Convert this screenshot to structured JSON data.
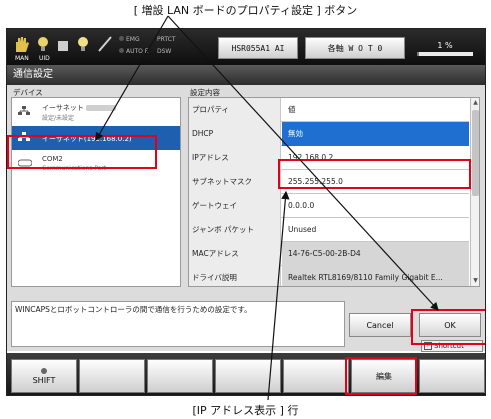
{
  "annotations": {
    "top": "[ 増設 LAN ボードのプロパティ設定 ] ボタン",
    "bottom": "[IP アドレス表示 ] 行"
  },
  "toolbar": {
    "icon_labels": [
      "MAN",
      "UID"
    ],
    "emg_label": "EMG",
    "auto_label": "AUTO E",
    "prtct_label": "PRTCT",
    "dsw_label": "DSW",
    "robot_button": "HSR055A1 AI",
    "axis_button": "各軸 W O T 0",
    "override_value": "1 %",
    "override_level": 0.01
  },
  "window": {
    "title": "通信設定"
  },
  "devices": {
    "header": "デバイス",
    "items": [
      {
        "line1": "イーサネット",
        "line2": "設定/未設定"
      },
      {
        "line1": "イーサネット(192.168.0.2)",
        "line2": ""
      },
      {
        "line1": "COM2",
        "line2": "Communications Port"
      }
    ]
  },
  "settings": {
    "header": "設定内容",
    "rows": [
      {
        "key": "プロパティ",
        "value": "値"
      },
      {
        "key": "DHCP",
        "value": "無効"
      },
      {
        "key": "IPアドレス",
        "value": "192.168.0.2"
      },
      {
        "key": "サブネットマスク",
        "value": "255.255.255.0"
      },
      {
        "key": "ゲートウェイ",
        "value": "0.0.0.0"
      },
      {
        "key": "ジャンボ パケット",
        "value": "Unused"
      },
      {
        "key": "MACアドレス",
        "value": "14-76-C5-00-2B-D4"
      },
      {
        "key": "ドライバ説明",
        "value": "Realtek RTL8169/8110 Family Gigabit E..."
      }
    ]
  },
  "description": "WINCAPSとロボットコントローラの間で通信を行うための設定です。",
  "buttons": {
    "cancel": "Cancel",
    "ok": "OK",
    "shortcut": "Shortcut"
  },
  "fkeys": {
    "shift": "SHIFT",
    "edit": "編集"
  },
  "colors": {
    "highlight": "#e3001b",
    "selected": "#1f5fb0",
    "dhcp_value_bg": "#1f6fd0"
  }
}
